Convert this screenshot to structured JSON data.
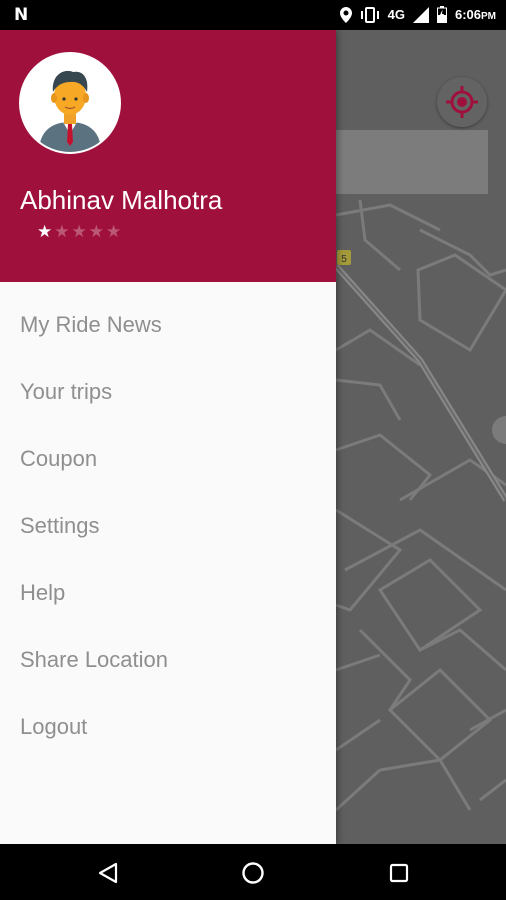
{
  "status_bar": {
    "network": "4G",
    "time": "6:06",
    "am_pm": "PM",
    "icons": [
      "notification-n-icon",
      "location-pin-icon",
      "vibrate-icon",
      "signal-icon",
      "battery-charging-icon"
    ]
  },
  "map": {
    "road_sign": "5"
  },
  "drawer": {
    "user_name": "Abhinav Malhotra",
    "rating": {
      "value": 1,
      "max": 5
    },
    "menu_items": [
      {
        "label": "My Ride News"
      },
      {
        "label": "Your trips"
      },
      {
        "label": "Coupon"
      },
      {
        "label": "Settings"
      },
      {
        "label": "Help"
      },
      {
        "label": "Share Location"
      },
      {
        "label": "Logout"
      }
    ]
  },
  "nav_bar": {
    "icons": [
      "back-triangle-icon",
      "home-circle-icon",
      "recents-square-icon"
    ]
  },
  "colors": {
    "header": "#a0103d",
    "drawer_bg": "#fafafa",
    "menu_text": "#8f8f8f",
    "map_bg": "#5f5f5f",
    "locate_red": "#a0103d"
  }
}
